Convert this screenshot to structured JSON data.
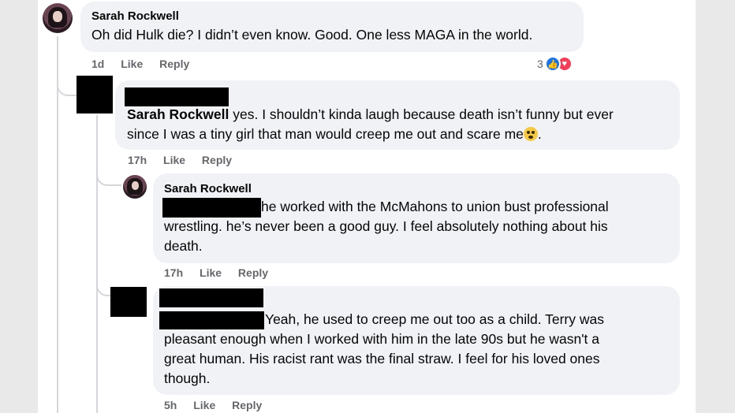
{
  "comments": [
    {
      "author": "Sarah Rockwell",
      "text": "Oh did Hulk die? I didn’t even know. Good. One less MAGA in the world.",
      "time": "1d",
      "like": "Like",
      "reply": "Reply",
      "reaction_count": "3"
    },
    {
      "mention": "Sarah Rockwell",
      "text_line1": " yes. I shouldn’t kinda laugh because death isn’t funny but ever",
      "text_line2": "since I was a tiny girl that man would creep me out and scare me",
      "time": "17h",
      "like": "Like",
      "reply": "Reply"
    },
    {
      "author": "Sarah Rockwell",
      "text_line1": " he worked with the McMahons to union bust professional",
      "text_line2": "wrestling. he’s never been a good guy. I feel absolutely nothing about his",
      "text_line3": "death.",
      "time": "17h",
      "like": "Like",
      "reply": "Reply"
    },
    {
      "text_line1": "Yeah, he used to creep me out too as a child. Terry was",
      "text_line2": "pleasant enough when I worked with him in the late 90s but he wasn't a",
      "text_line3": "great human. His racist rant was the final straw. I feel for his loved ones",
      "text_line4": "though.",
      "time": "5h",
      "like": "Like",
      "reply": "Reply"
    }
  ],
  "icons": {
    "like": "thumbs-up-icon",
    "love": "heart-icon",
    "emoji": "anxious-face-emoji"
  },
  "colors": {
    "like": "#1b74e4",
    "love": "#f33e58",
    "bubble": "#f0f2f5"
  }
}
